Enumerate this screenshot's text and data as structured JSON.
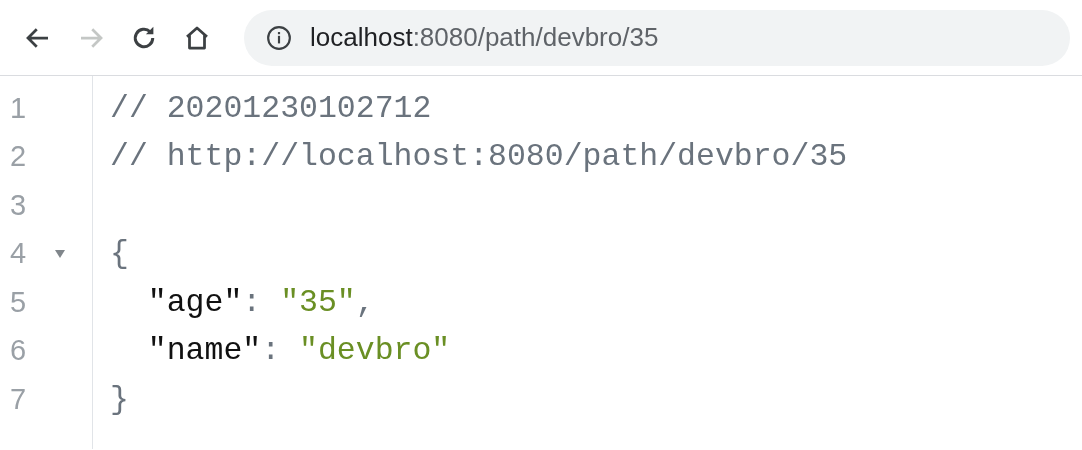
{
  "toolbar": {
    "nav_buttons": [
      {
        "kind": "back",
        "disabled": false
      },
      {
        "kind": "forward",
        "disabled": true
      },
      {
        "kind": "reload",
        "disabled": false
      },
      {
        "kind": "home",
        "disabled": false
      }
    ],
    "address": {
      "host": "localhost",
      "rest": ":8080/path/devbro/35"
    }
  },
  "editor": {
    "lines": [
      {
        "number": "1",
        "foldable": false,
        "tokens": [
          {
            "kind": "comment",
            "text": "// 20201230102712"
          }
        ]
      },
      {
        "number": "2",
        "foldable": false,
        "tokens": [
          {
            "kind": "comment",
            "text": "// http://localhost:8080/path/devbro/35"
          }
        ]
      },
      {
        "number": "3",
        "foldable": false
      },
      {
        "number": "4",
        "foldable": true,
        "expanded": true,
        "tokens": [
          {
            "kind": "punct",
            "text": "{"
          }
        ]
      },
      {
        "number": "5",
        "foldable": false,
        "tokens": [
          {
            "kind": "key",
            "text": "  \"age\""
          },
          {
            "kind": "punct",
            "text": ": "
          },
          {
            "kind": "string",
            "text": "\"35\""
          },
          {
            "kind": "punct",
            "text": ","
          }
        ]
      },
      {
        "number": "6",
        "foldable": false,
        "tokens": [
          {
            "kind": "key",
            "text": "  \"name\""
          },
          {
            "kind": "punct",
            "text": ": "
          },
          {
            "kind": "string",
            "text": "\"devbro\""
          }
        ]
      },
      {
        "number": "7",
        "foldable": false,
        "tokens": [
          {
            "kind": "punct",
            "text": "}"
          }
        ]
      }
    ]
  }
}
